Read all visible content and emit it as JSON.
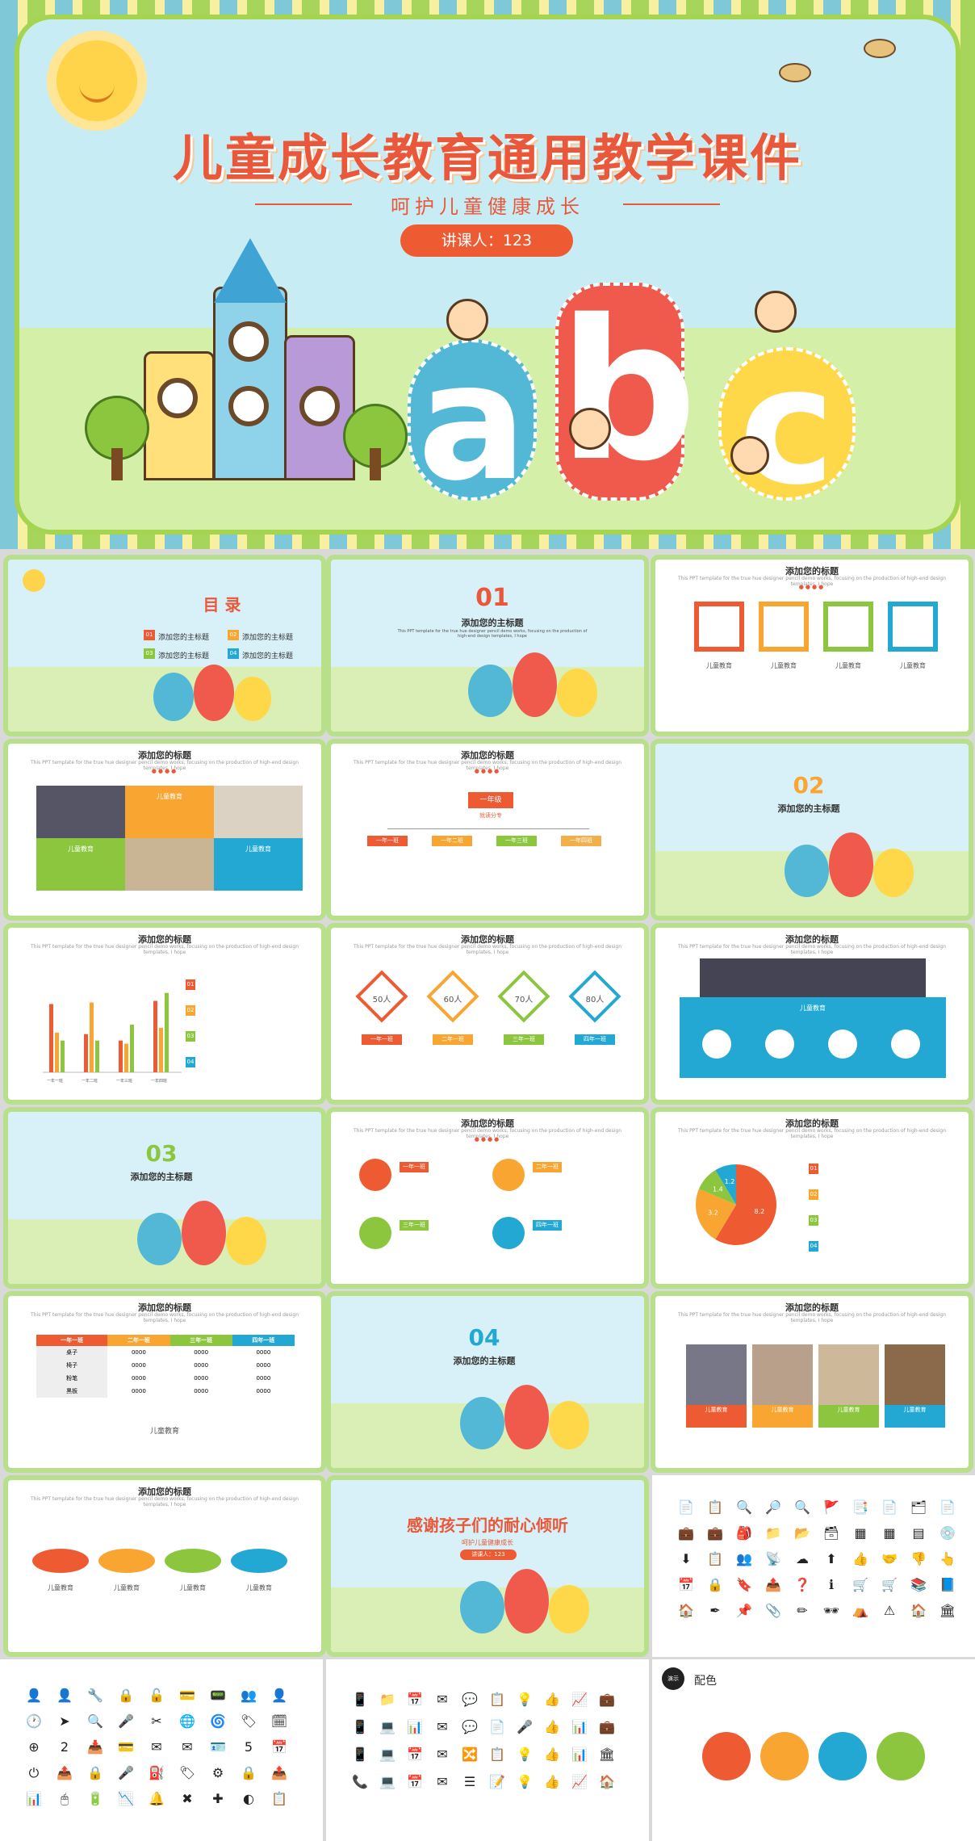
{
  "hero": {
    "title": "儿童成长教育通用教学课件",
    "subtitle": "呵护儿童健康成长",
    "presenter": "讲课人：123",
    "letters": [
      "a",
      "b",
      "c"
    ]
  },
  "toc": {
    "title": "目 录",
    "items": [
      "添加您的主标题",
      "添加您的主标题",
      "添加您的主标题",
      "添加您的主标题"
    ],
    "nums": [
      "01",
      "02",
      "03",
      "04"
    ]
  },
  "common": {
    "slide_title": "添加您的主标题",
    "add_title": "添加您的标题",
    "filler": "This PPT template for the true hue designer pencil demo works, focusing on the production of high-end design templates, I hope",
    "kid_label": "儿童教育",
    "dots": "●●●●"
  },
  "sections": [
    "01",
    "02",
    "03",
    "04"
  ],
  "slide3": {
    "labels": [
      "儿童教育",
      "儿童教育",
      "儿童教育",
      "儿童教育"
    ]
  },
  "slide4": {
    "labels": [
      "儿童教育",
      "儿童教育",
      "儿童教育"
    ]
  },
  "slide5": {
    "top": "一年级",
    "sub": "就读分专",
    "boxes": [
      "一年一班",
      "一年二班",
      "一年三班",
      "一年四班"
    ]
  },
  "slide7": {
    "chart_data": {
      "type": "bar",
      "categories": [
        "一年一班",
        "一年二班",
        "一年三班",
        "一年四班"
      ],
      "series": [
        {
          "values": [
            4.3,
            2.4,
            2,
            4.5
          ]
        },
        {
          "values": [
            2.5,
            4.4,
            1.8,
            2.8
          ]
        },
        {
          "values": [
            2,
            2,
            3,
            5
          ]
        }
      ],
      "ylim": [
        0,
        6
      ]
    },
    "legend_nums": [
      "01",
      "02",
      "03",
      "04"
    ]
  },
  "slide8": {
    "diamonds": [
      "50人",
      "60人",
      "70人",
      "80人"
    ],
    "tags": [
      "一年一班",
      "二年一班",
      "三年一班",
      "四年一班"
    ]
  },
  "slide9": {
    "banner": "儿童教育"
  },
  "slide11": {
    "tags": [
      "一年一班",
      "二年一班",
      "三年一班",
      "四年一班"
    ]
  },
  "slide12": {
    "chart_data": {
      "type": "pie",
      "categories": [
        "一年一班",
        "二年一班",
        "三年一班",
        "四年一班"
      ],
      "values": [
        8.2,
        3.2,
        1.4,
        1.2
      ]
    },
    "legend_nums": [
      "01",
      "02",
      "03",
      "04"
    ]
  },
  "slide13": {
    "headers": [
      "一年一班",
      "二年一班",
      "三年一班",
      "四年一班"
    ],
    "rows": [
      [
        "桌子",
        "0000",
        "0000",
        "0000"
      ],
      [
        "椅子",
        "0000",
        "0000",
        "0000"
      ],
      [
        "粉笔",
        "0000",
        "0000",
        "0000"
      ],
      [
        "黑板",
        "0000",
        "0000",
        "0000"
      ]
    ],
    "caption": "儿童教育"
  },
  "slide15": {
    "labels": [
      "儿童教育",
      "儿童教育",
      "儿童教育",
      "儿童教育"
    ]
  },
  "slide16": {
    "labels": [
      "儿童教育",
      "儿童教育",
      "儿童教育",
      "儿童教育"
    ]
  },
  "thanks": {
    "title": "感谢孩子们的耐心倾听",
    "subtitle": "呵护儿童健康成长",
    "presenter": "讲课人：123"
  },
  "palette": {
    "label": "配色",
    "badge": "演示",
    "colors": [
      "#ee5b33",
      "#f9a531",
      "#22a8d2",
      "#8cc63f"
    ]
  },
  "colors": {
    "red": "#ee5b33",
    "orange": "#f9a531",
    "green": "#8cc63f",
    "blue": "#22a8d2"
  },
  "icons1": [
    "📄",
    "📋",
    "🔍",
    "🔎",
    "🔍",
    "🚩",
    "📑",
    "📄",
    "🗂",
    "📄",
    "💼",
    "💼",
    "🎒",
    "📁",
    "📂",
    "🗃",
    "▦",
    "▦",
    "▤",
    "💿",
    "⬇",
    "📋",
    "👥",
    "📡",
    "☁",
    "⬆",
    "👍",
    "🤝",
    "👎",
    "👆",
    "📅",
    "🔒",
    "🔖",
    "📤",
    "❓",
    "ℹ",
    "🛒",
    "🛒",
    "📚",
    "📘",
    "🏠",
    "✒",
    "📌",
    "📎",
    "✏",
    "🕶",
    "⛺",
    "⚠",
    "🏠",
    "🏛"
  ],
  "icons2": [
    "👤",
    "👤",
    "🔧",
    "🔒",
    "🔓",
    "💳",
    "📟",
    "👥",
    "👤",
    "🕐",
    "➤",
    "🔍",
    "🎤",
    "✂",
    "🌐",
    "🌀",
    "🏷",
    "🗓",
    "⊕",
    "2",
    "📥",
    "💳",
    "✉",
    "✉",
    "🪪",
    "5",
    "📅",
    "⏻",
    "📤",
    "🔒",
    "🎤",
    "⛽",
    "🏷",
    "⚙",
    "🔒",
    "📤",
    "📊",
    "🖱",
    "🔋",
    "📉",
    "🔔",
    "✖",
    "✚",
    "◐",
    "📋"
  ],
  "icons3": [
    "📱",
    "📁",
    "📅",
    "✉",
    "💬",
    "📋",
    "💡",
    "👍",
    "📈",
    "💼",
    "📱",
    "💻",
    "📊",
    "✉",
    "💬",
    "📄",
    "🎤",
    "👍",
    "📊",
    "💼",
    "📱",
    "💻",
    "📅",
    "✉",
    "🔀",
    "📋",
    "💡",
    "👍",
    "📊",
    "🏛",
    "📞",
    "💻",
    "📅",
    "✉",
    "☰",
    "📝",
    "💡",
    "👍",
    "📈",
    "🏠"
  ]
}
